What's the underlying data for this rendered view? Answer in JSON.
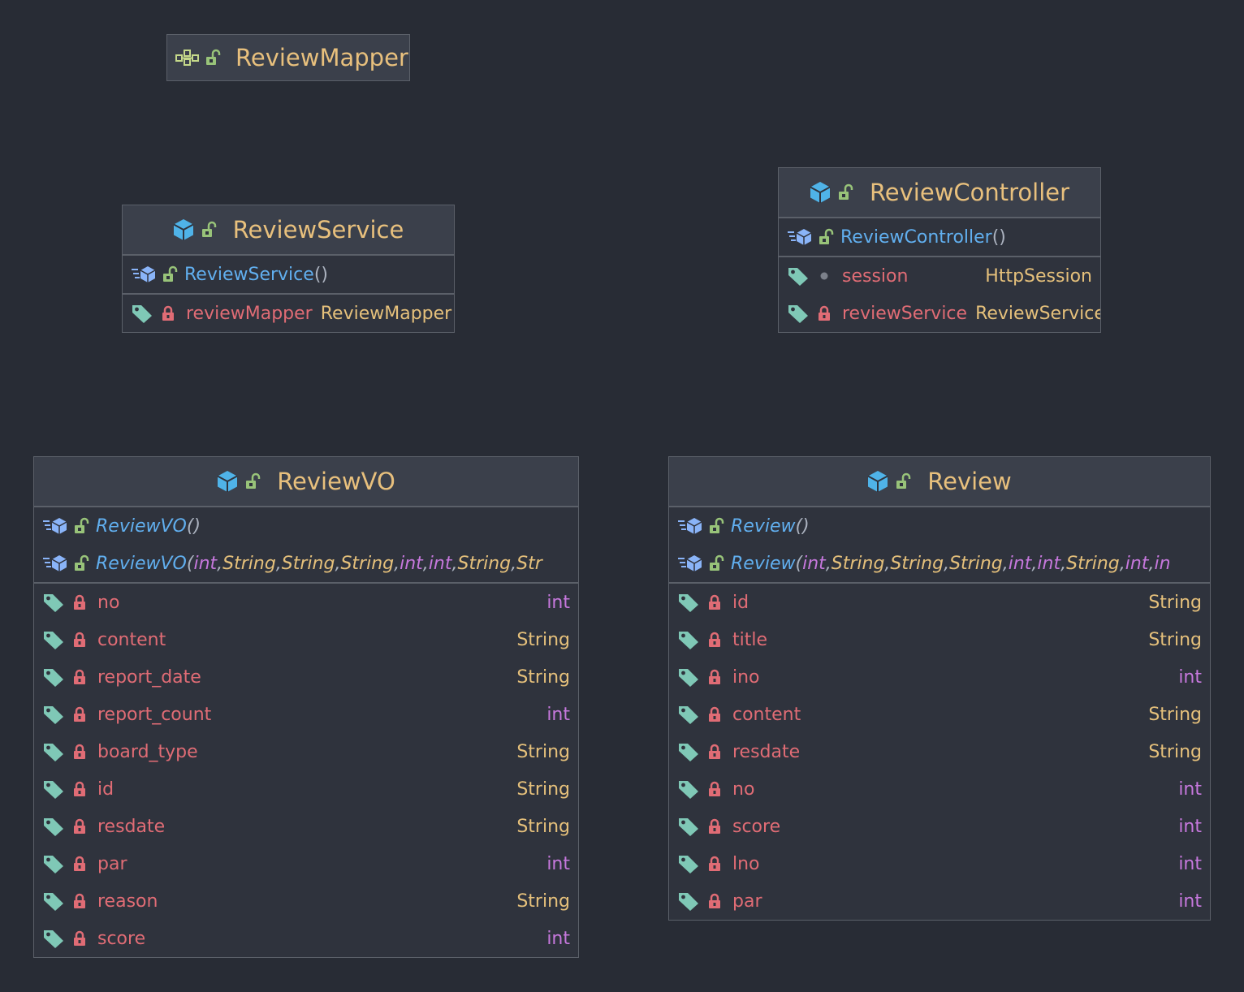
{
  "colors": {
    "background": "#282c35",
    "class_header": "#3b404b",
    "class_title": "#e8c07d",
    "constructor": "#61afef",
    "field_name": "#e06c75",
    "type_string": "#e5c07b",
    "type_int": "#c678dd",
    "tag_icon": "#7fc8b6",
    "lock_icon": "#e06c75",
    "open_lock_icon": "#98c379",
    "class_icon": "#4fb3e8"
  },
  "nodes": {
    "mapper": {
      "title": "ReviewMapper",
      "icons": [
        "interface-icon",
        "public-unlock-icon"
      ]
    },
    "service": {
      "title": "ReviewService",
      "constructor": {
        "name": "ReviewService",
        "parens": "()"
      },
      "fields": [
        {
          "name": "reviewMapper",
          "type": "ReviewMapper",
          "access": "private"
        }
      ]
    },
    "controller": {
      "title": "ReviewController",
      "constructor": {
        "name": "ReviewController",
        "parens": "()"
      },
      "fields": [
        {
          "name": "session",
          "type": "HttpSession",
          "access": "package"
        },
        {
          "name": "reviewService",
          "type": "ReviewService",
          "access": "private"
        }
      ]
    },
    "reviewvo": {
      "title": "ReviewVO",
      "ctor_default": {
        "name": "ReviewVO",
        "parens": "()"
      },
      "ctor_full_name": "ReviewVO",
      "ctor_full_params": [
        "int",
        "String",
        "String",
        "String",
        "int",
        "int",
        "String",
        "Str"
      ],
      "fields": [
        {
          "name": "no",
          "type": "int"
        },
        {
          "name": "content",
          "type": "String"
        },
        {
          "name": "report_date",
          "type": "String"
        },
        {
          "name": "report_count",
          "type": "int"
        },
        {
          "name": "board_type",
          "type": "String"
        },
        {
          "name": "id",
          "type": "String"
        },
        {
          "name": "resdate",
          "type": "String"
        },
        {
          "name": "par",
          "type": "int"
        },
        {
          "name": "reason",
          "type": "String"
        },
        {
          "name": "score",
          "type": "int"
        }
      ]
    },
    "review": {
      "title": "Review",
      "ctor_default": {
        "name": "Review",
        "parens": "()"
      },
      "ctor_full_name": "Review",
      "ctor_full_params": [
        "int",
        "String",
        "String",
        "String",
        "int",
        "int",
        "String",
        "int",
        "in"
      ],
      "fields": [
        {
          "name": "id",
          "type": "String"
        },
        {
          "name": "title",
          "type": "String"
        },
        {
          "name": "ino",
          "type": "int"
        },
        {
          "name": "content",
          "type": "String"
        },
        {
          "name": "resdate",
          "type": "String"
        },
        {
          "name": "no",
          "type": "int"
        },
        {
          "name": "score",
          "type": "int"
        },
        {
          "name": "lno",
          "type": "int"
        },
        {
          "name": "par",
          "type": "int"
        }
      ]
    }
  }
}
